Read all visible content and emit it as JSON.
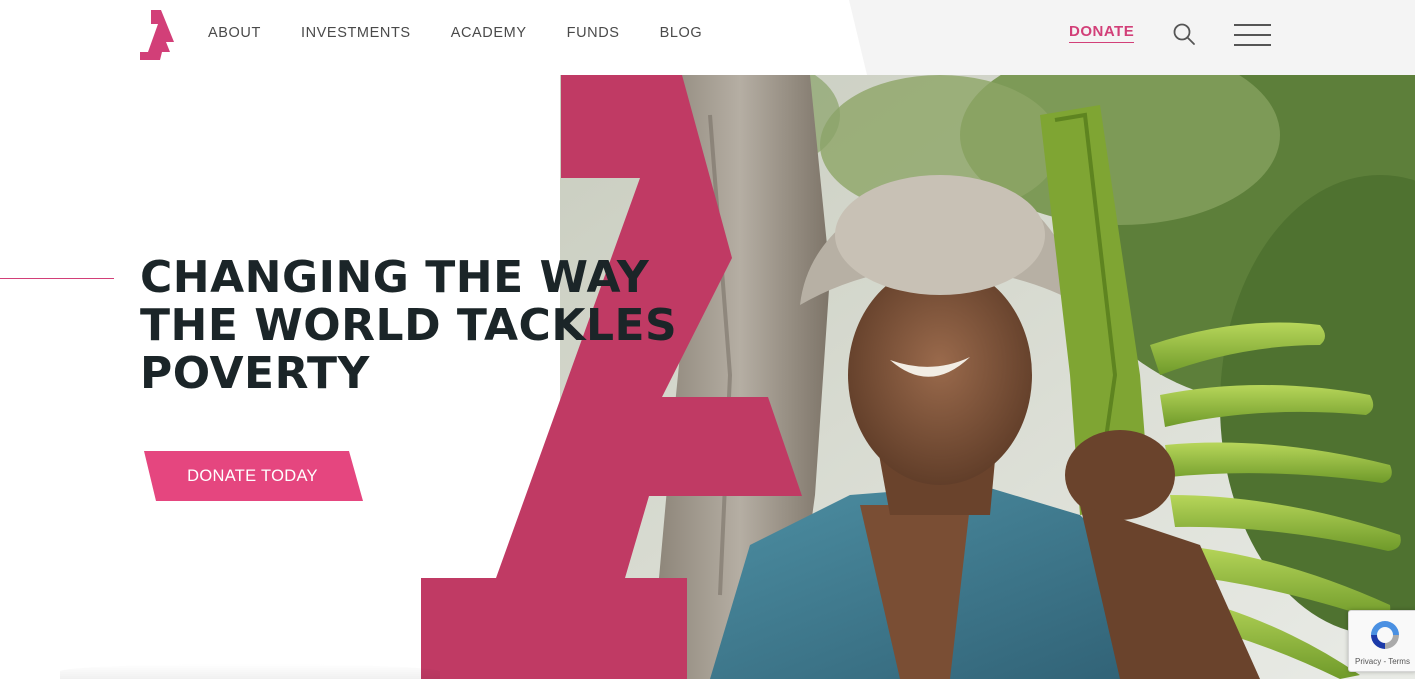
{
  "nav": {
    "logo_alt": "Logo",
    "items": [
      {
        "label": "ABOUT"
      },
      {
        "label": "INVESTMENTS"
      },
      {
        "label": "ACADEMY"
      },
      {
        "label": "FUNDS"
      },
      {
        "label": "BLOG"
      }
    ],
    "donate_label": "DONATE",
    "search_icon": "search-icon",
    "menu_icon": "hamburger-menu-icon"
  },
  "hero": {
    "headline_lines": [
      "CHANGING THE WAY",
      "THE WORLD TACKLES",
      "POVERTY"
    ],
    "cta_label": "DONATE TODAY",
    "image_alt": "Smiling farmer carrying a stalk of green bananas on his shoulder"
  },
  "recaptcha": {
    "text": "Privacy - Terms"
  },
  "colors": {
    "brand_pink": "#d23f78",
    "cta_pink": "#e5467f",
    "shape_magenta": "#c03a64",
    "headline_dark": "#1b2528",
    "nav_text": "#4a4a4a"
  }
}
